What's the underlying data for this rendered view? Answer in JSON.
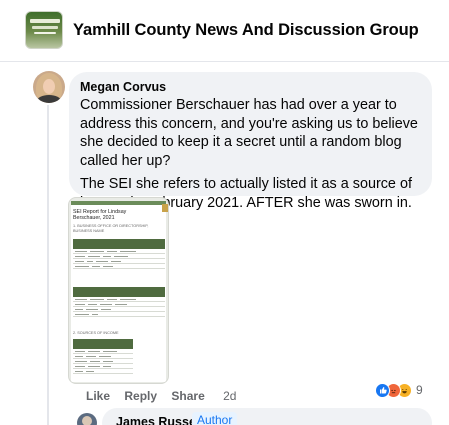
{
  "group": {
    "name": "Yamhill County News And Discussion Group"
  },
  "comment": {
    "author": "Megan Corvus",
    "paragraphs": [
      "Commissioner Berschauer has had over a year to address this concern, and you're asking us to believe she decided to keep it a secret until a random blog called her up?",
      "The SEI she refers to actually listed it as a source of income in February 2021. AFTER she was sworn in."
    ],
    "attachment": {
      "title": "SEI Report for Lindsay Berschauer, 2021",
      "section1": "1. BUSINESS OFFICE OR DIRECTORSHIP, BUSINESS NAME",
      "section2": "2. SOURCES OF INCOME"
    },
    "actions": {
      "like": "Like",
      "reply": "Reply",
      "share": "Share",
      "time": "2d"
    },
    "reactions": {
      "icons": [
        "like-icon",
        "angry-icon",
        "haha-icon"
      ],
      "count": "9"
    }
  },
  "next_comment": {
    "author": "James Russell",
    "badge": "Author"
  },
  "colors": {
    "like_blue": "#1877f2",
    "bubble_bg": "#f0f2f5",
    "muted_text": "#65676b"
  }
}
